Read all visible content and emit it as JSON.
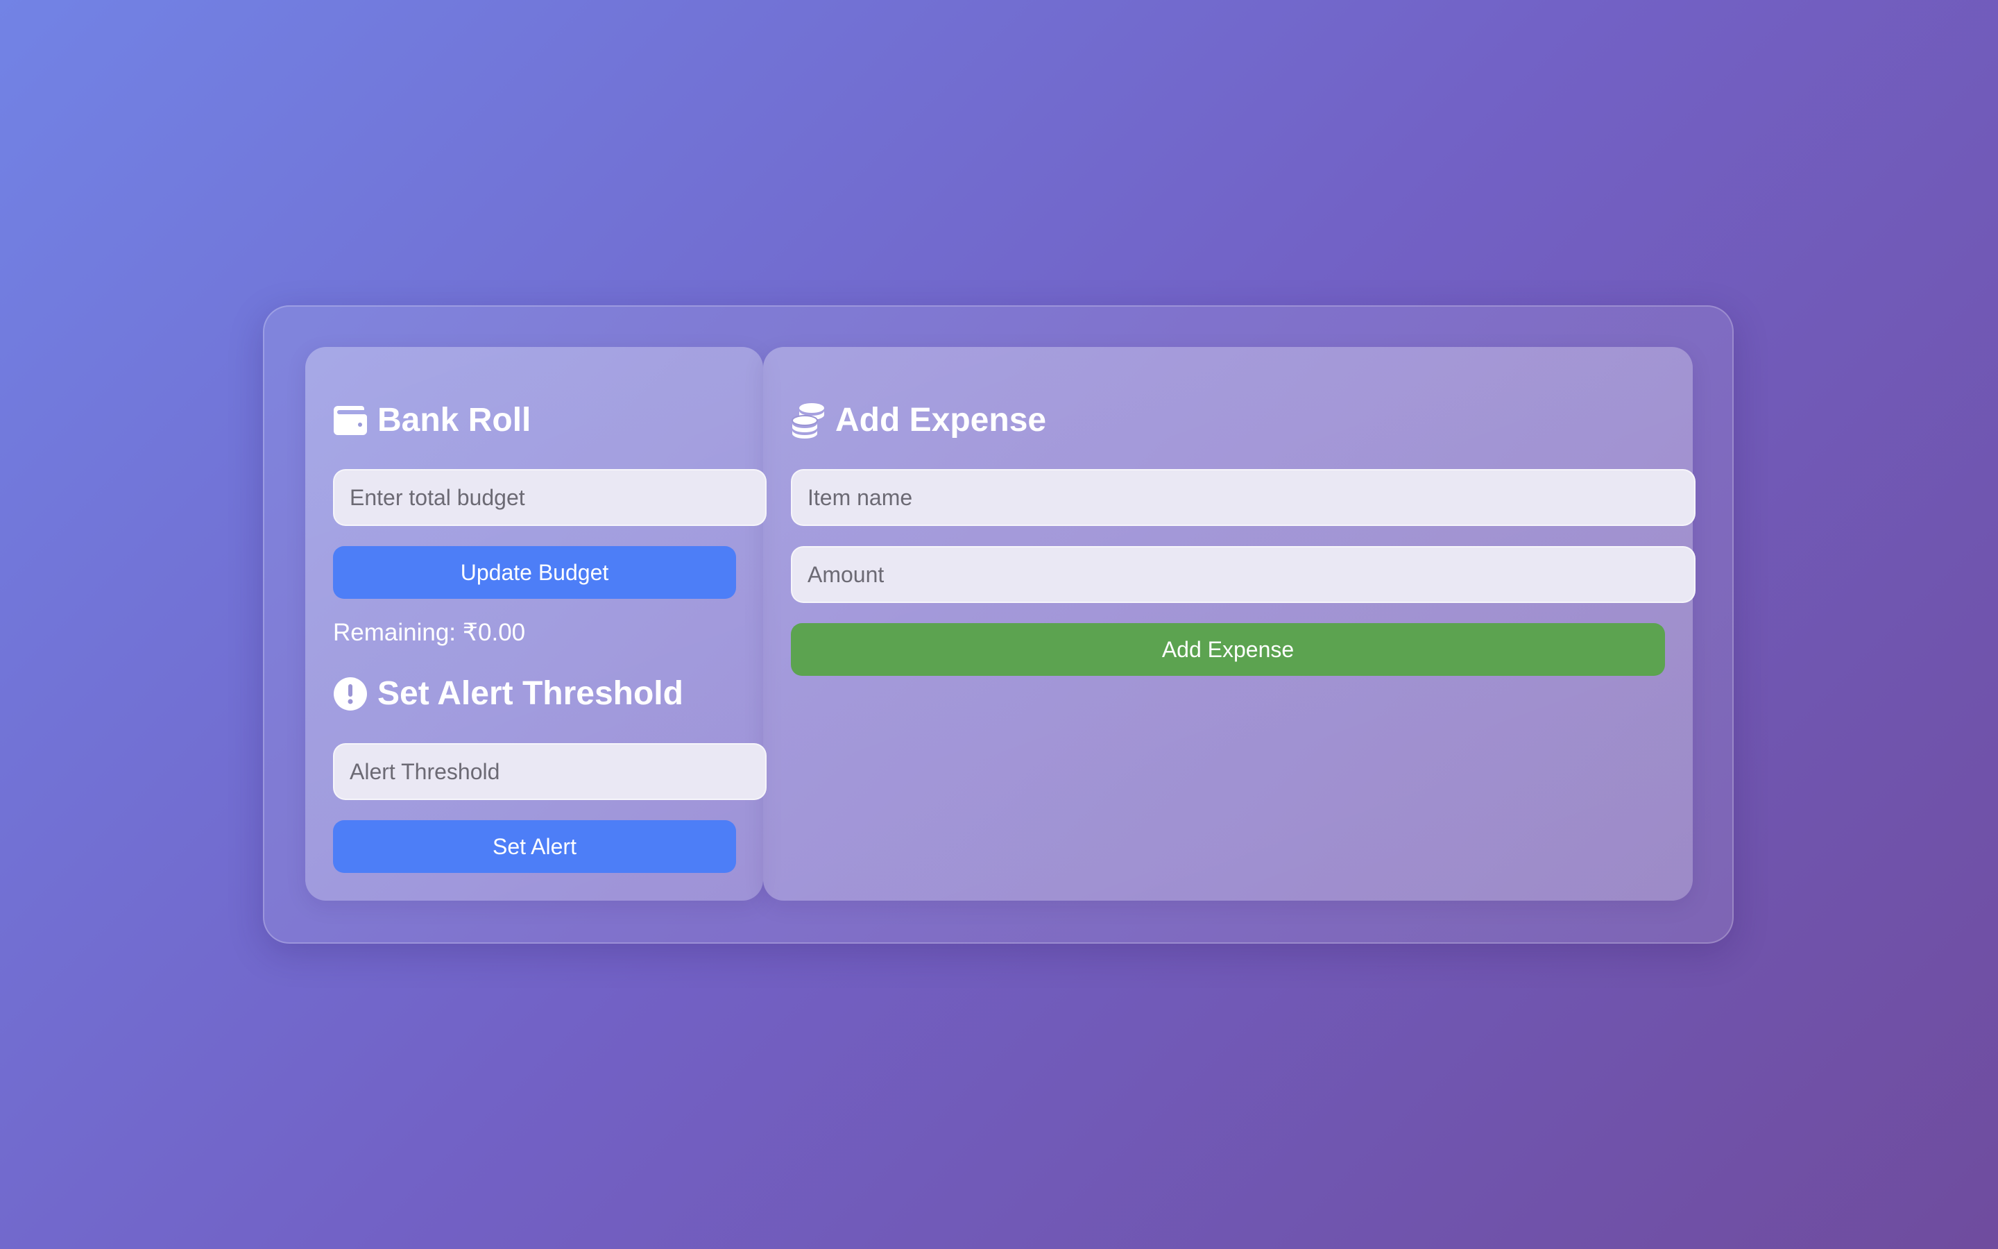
{
  "bank_roll": {
    "title": "Bank Roll",
    "icon": "wallet-icon",
    "budget_placeholder": "Enter total budget",
    "update_button": "Update Budget",
    "remaining_label": "Remaining: ₹0.00"
  },
  "alert": {
    "title": "Set Alert Threshold",
    "icon": "exclamation-circle-icon",
    "threshold_placeholder": "Alert Threshold",
    "set_button": "Set Alert"
  },
  "expense": {
    "title": "Add Expense",
    "icon": "coins-icon",
    "item_placeholder": "Item name",
    "amount_placeholder": "Amount",
    "add_button": "Add Expense"
  },
  "colors": {
    "primary_button": "#4d7ef7",
    "success_button": "#5ca350",
    "background_start": "#7283e5",
    "background_end": "#6f4c9e"
  }
}
